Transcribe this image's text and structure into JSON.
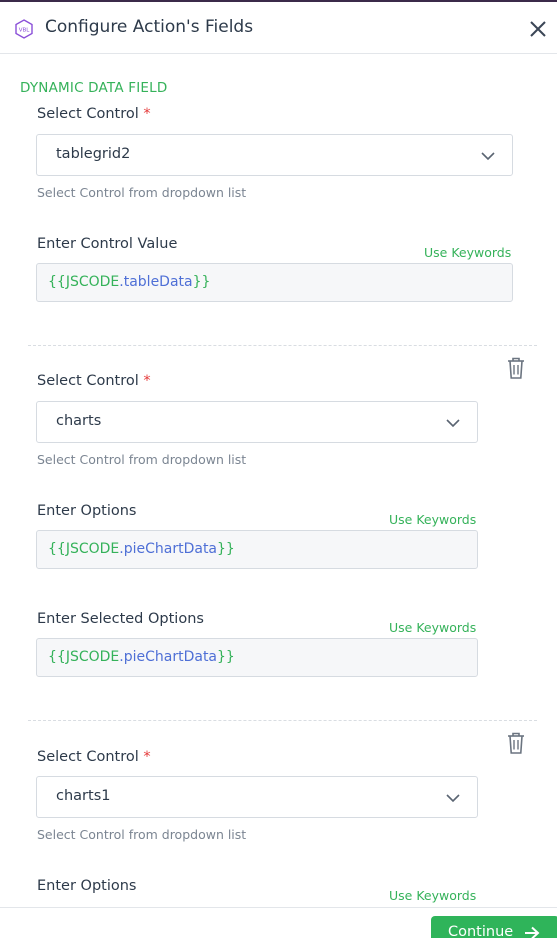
{
  "header": {
    "logo_text": "VBL",
    "title": "Configure Action's Fields"
  },
  "section_title": "DYNAMIC DATA FIELD",
  "colors": {
    "accent_green": "#35b25a",
    "required_red": "#e53b3b",
    "code_blue": "#4e6fd6"
  },
  "icons": {
    "close": "close-icon",
    "chevron": "chevron-down-icon",
    "trash": "trash-icon",
    "arrow": "arrow-right-icon"
  },
  "blocks": [
    {
      "select_label": "Select Control",
      "required_mark": "*",
      "select_value": "tablegrid2",
      "select_help": "Select Control from dropdown list",
      "fields": [
        {
          "label": "Enter Control Value",
          "keywords": "Use Keywords",
          "open": "{{",
          "obj": "JSCODE",
          "dot": ".",
          "prop": "tableData",
          "close": "}}"
        }
      ]
    },
    {
      "select_label": "Select Control",
      "required_mark": "*",
      "select_value": "charts",
      "select_help": "Select Control from dropdown list",
      "fields": [
        {
          "label": "Enter Options",
          "keywords": "Use Keywords",
          "open": "{{",
          "obj": "JSCODE",
          "dot": ".",
          "prop": "pieChartData",
          "close": "}}"
        },
        {
          "label": "Enter Selected Options",
          "keywords": "Use Keywords",
          "open": "{{",
          "obj": "JSCODE",
          "dot": ".",
          "prop": "pieChartData",
          "close": "}}"
        }
      ]
    },
    {
      "select_label": "Select Control",
      "required_mark": "*",
      "select_value": "charts1",
      "select_help": "Select Control from dropdown list",
      "fields": [
        {
          "label": "Enter Options",
          "keywords": "Use Keywords"
        }
      ]
    }
  ],
  "footer": {
    "continue_label": "Continue"
  }
}
